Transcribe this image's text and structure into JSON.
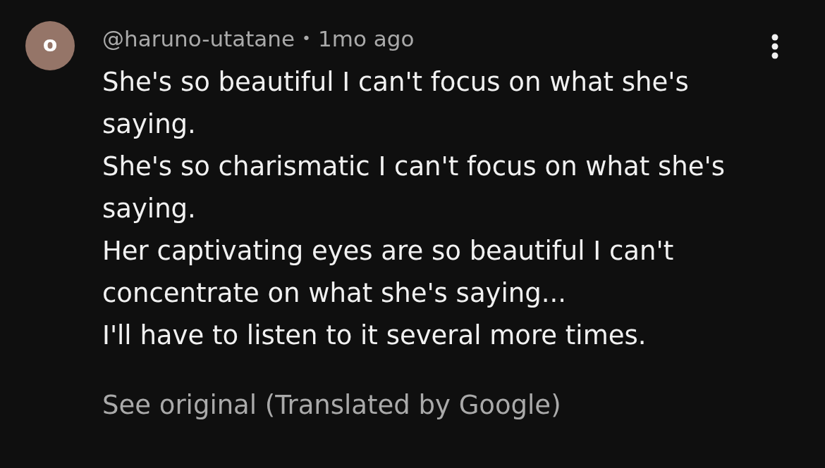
{
  "comment": {
    "avatar": {
      "initial": "o"
    },
    "author": "@haruno-utatane",
    "separator": "•",
    "time": "1mo ago",
    "text_lines": [
      "She's so beautiful I can't focus on what she's saying.",
      "She's so charismatic I can't focus on what she's saying.",
      "Her captivating eyes are so beautiful I can't concentrate on what she's saying...",
      "I'll have to listen to it several more times."
    ],
    "translation_link": "See original (Translated by Google)"
  }
}
